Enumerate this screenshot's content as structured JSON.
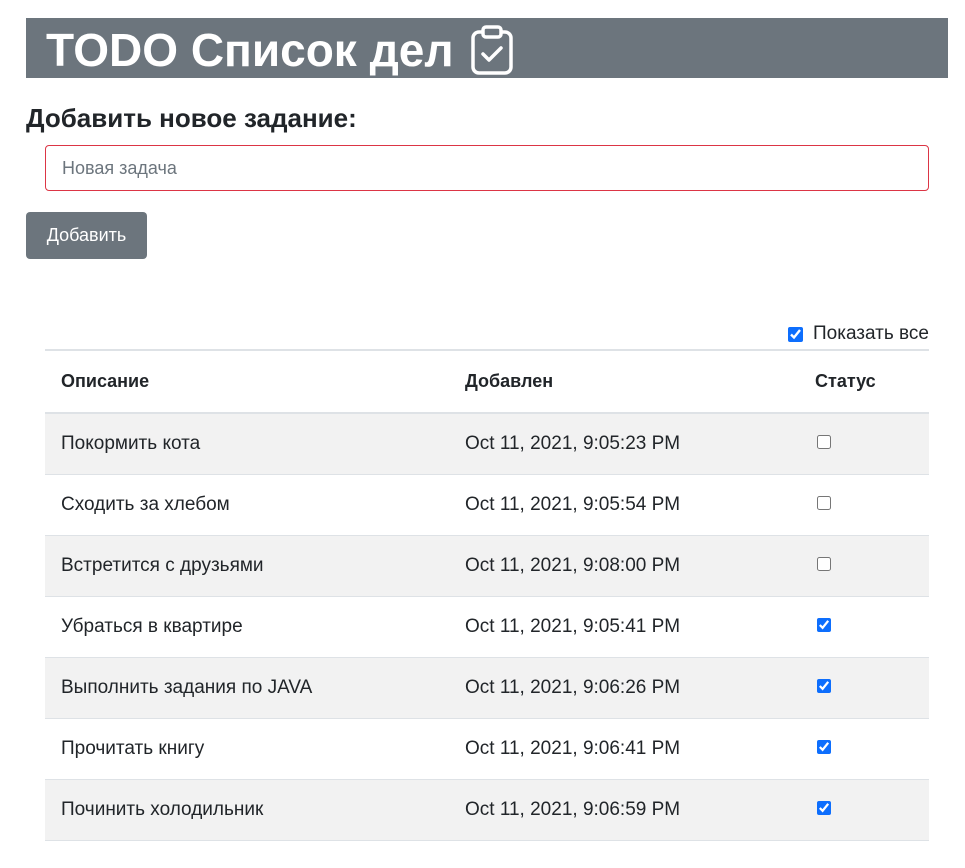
{
  "header": {
    "title": "TODO Список дел",
    "icon": "clipboard-check-icon",
    "background": "#6c757d"
  },
  "form": {
    "heading": "Добавить новое задание:",
    "input_placeholder": "Новая задача",
    "input_value": "",
    "add_label": "Добавить"
  },
  "filter": {
    "show_all_label": "Показать все",
    "show_all_checked": true
  },
  "table": {
    "columns": [
      "Описание",
      "Добавлен",
      "Статус"
    ],
    "rows": [
      {
        "description": "Покормить кота",
        "added": "Oct 11, 2021, 9:05:23 PM",
        "done": false
      },
      {
        "description": "Сходить за хлебом",
        "added": "Oct 11, 2021, 9:05:54 PM",
        "done": false
      },
      {
        "description": "Встретится с друзьями",
        "added": "Oct 11, 2021, 9:08:00 PM",
        "done": false
      },
      {
        "description": "Убраться в квартире",
        "added": "Oct 11, 2021, 9:05:41 PM",
        "done": true
      },
      {
        "description": "Выполнить задания по JAVA",
        "added": "Oct 11, 2021, 9:06:26 PM",
        "done": true
      },
      {
        "description": "Прочитать книгу",
        "added": "Oct 11, 2021, 9:06:41 PM",
        "done": true
      },
      {
        "description": "Починить холодильник",
        "added": "Oct 11, 2021, 9:06:59 PM",
        "done": true
      }
    ]
  }
}
